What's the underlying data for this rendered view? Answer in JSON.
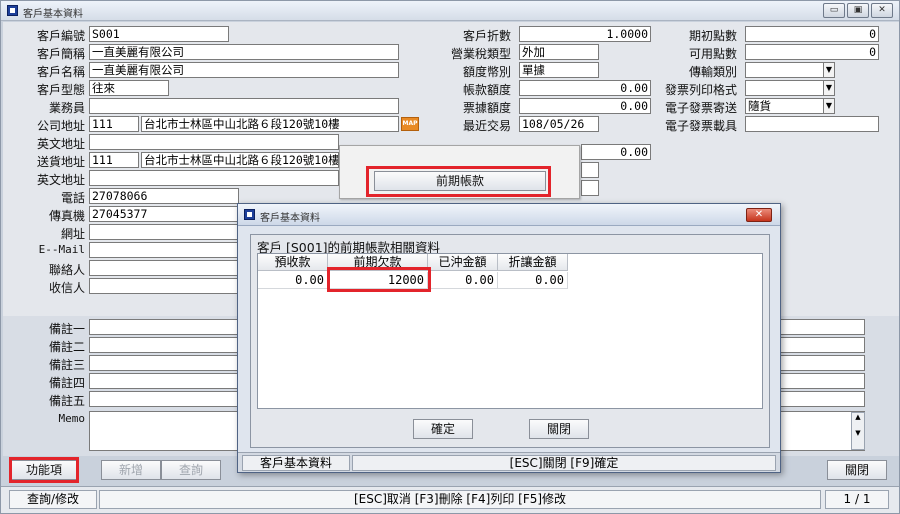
{
  "window": {
    "title": "客戶基本資料"
  },
  "fields": {
    "customer_no": {
      "label": "客戶編號",
      "value": "S001"
    },
    "short_name": {
      "label": "客戶簡稱",
      "value": "一直美麗有限公司"
    },
    "full_name": {
      "label": "客戶名稱",
      "value": "一直美麗有限公司"
    },
    "customer_type": {
      "label": "客戶型態",
      "value": "往來"
    },
    "salesperson": {
      "label": "業務員",
      "value": ""
    },
    "company_address": {
      "label": "公司地址",
      "zip": "111",
      "value": "台北市士林區中山北路６段120號10樓"
    },
    "company_address_en": {
      "label": "英文地址",
      "value": ""
    },
    "delivery_address": {
      "label": "送貨地址",
      "zip": "111",
      "value": "台北市士林區中山北路６段120號10樓"
    },
    "delivery_address_en": {
      "label": "英文地址",
      "value": ""
    },
    "phone": {
      "label": "電話",
      "value": "27078066"
    },
    "fax": {
      "label": "傳真機",
      "value": "27045377"
    },
    "website": {
      "label": "網址",
      "value": ""
    },
    "email": {
      "label": "E--Mail",
      "value": ""
    },
    "contact": {
      "label": "聯絡人",
      "value": ""
    },
    "recipient": {
      "label": "收信人",
      "value": ""
    },
    "discount": {
      "label": "客戶折數",
      "value": "1.0000"
    },
    "tax_type": {
      "label": "營業稅類型",
      "value": "外加"
    },
    "limit_currency": {
      "label": "額度幣別",
      "value": "單據"
    },
    "account_limit": {
      "label": "帳款額度",
      "value": "0.00"
    },
    "note_limit": {
      "label": "票據額度",
      "value": "0.00"
    },
    "last_trade": {
      "label": "最近交易",
      "value": "108/05/26"
    },
    "unlabeled_amount": {
      "value": "0.00"
    },
    "opening_points": {
      "label": "期初點數",
      "value": "0"
    },
    "available_points": {
      "label": "可用點數",
      "value": "0"
    },
    "shipping_type": {
      "label": "傳輸類別",
      "value": ""
    },
    "invoice_print": {
      "label": "發票列印格式",
      "value": ""
    },
    "einvoice_send": {
      "label": "電子發票寄送",
      "value": "隨貨"
    },
    "einvoice_carrier": {
      "label": "電子發票載具",
      "value": ""
    },
    "remark1": {
      "label": "備註一",
      "value": ""
    },
    "remark2": {
      "label": "備註二",
      "value": ""
    },
    "remark3": {
      "label": "備註三",
      "value": ""
    },
    "remark4": {
      "label": "備註四",
      "value": ""
    },
    "remark5": {
      "label": "備註五",
      "value": ""
    },
    "memo": {
      "label": "Memo",
      "value": ""
    }
  },
  "map_button": "MAP",
  "popup_menu": {
    "item": "前期帳款"
  },
  "toolbar": {
    "function_label": "功能項",
    "add_label": "新增",
    "query_label": "查詢",
    "close_label": "關閉"
  },
  "statusbar": {
    "mode": "查詢/修改",
    "hints": "[ESC]取消 [F3]刪除 [F4]列印 [F5]修改",
    "page": "1 / 1"
  },
  "dialog": {
    "title": "客戶基本資料",
    "heading": "客戶 [S001]的前期帳款相關資料",
    "columns": [
      "預收款",
      "前期欠款",
      "已沖金額",
      "折讓金額"
    ],
    "rows": [
      [
        "0.00",
        "12000",
        "0.00",
        "0.00"
      ]
    ],
    "ok_label": "確定",
    "close_label": "關閉",
    "status_left": "客戶基本資料",
    "status_hint": "[ESC]關閉 [F9]確定"
  },
  "colors": {
    "highlight": "#e3242b",
    "title_icon": "#1d3f9a",
    "map": "#e88a24"
  }
}
